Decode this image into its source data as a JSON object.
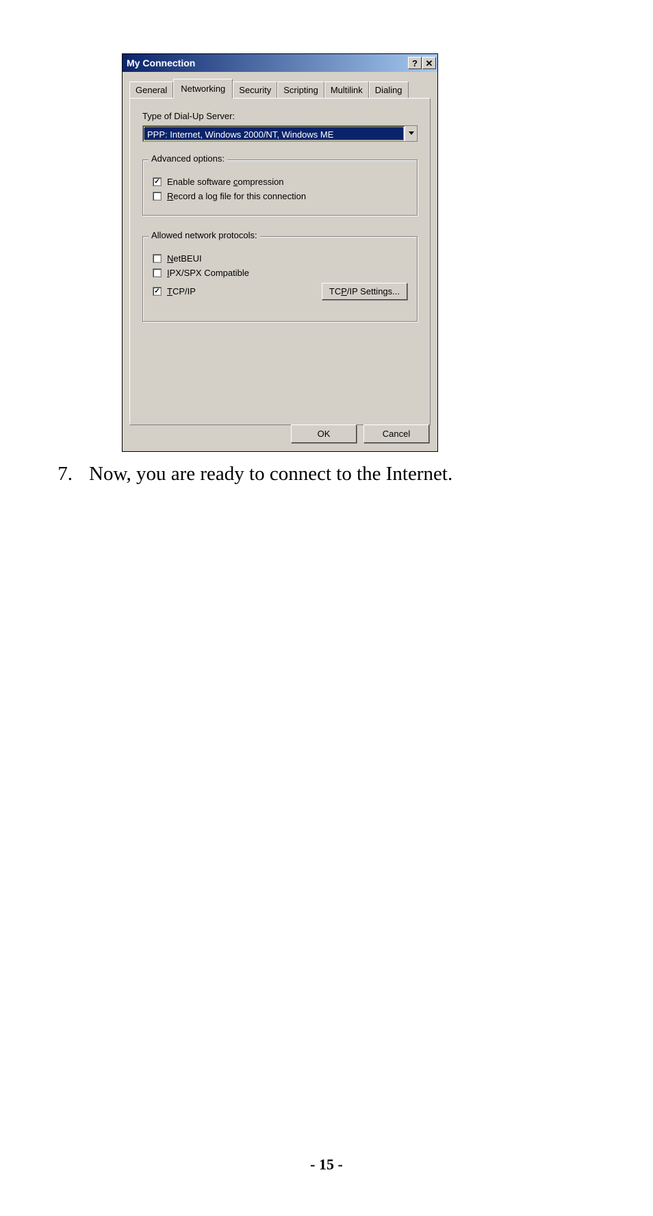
{
  "dialog": {
    "title": "My Connection",
    "tabs": [
      "General",
      "Networking",
      "Security",
      "Scripting",
      "Multilink",
      "Dialing"
    ],
    "active_tab_index": 1,
    "server_type_label": "Type of Dial-Up Server:",
    "server_type_value": "PPP: Internet, Windows 2000/NT, Windows ME",
    "advanced": {
      "legend": "Advanced options:",
      "compress": {
        "checked": true,
        "pre": "Enable software ",
        "u": "c",
        "post": "ompression"
      },
      "record": {
        "checked": false,
        "u": "R",
        "post": "ecord a log file for this connection"
      }
    },
    "protocols": {
      "legend": "Allowed network protocols:",
      "netbeui": {
        "checked": false,
        "u": "N",
        "post": "etBEUI"
      },
      "ipx": {
        "checked": false,
        "u": "I",
        "post": "PX/SPX Compatible"
      },
      "tcpip": {
        "checked": true,
        "u": "T",
        "post": "CP/IP"
      },
      "settings_btn_pre": "TC",
      "settings_btn_u": "P",
      "settings_btn_post": "/IP Settings..."
    },
    "ok": "OK",
    "cancel": "Cancel"
  },
  "doc": {
    "step_num": "7.",
    "step_text": "Now, you are ready to connect to the Internet.",
    "page": "- 15 -"
  }
}
